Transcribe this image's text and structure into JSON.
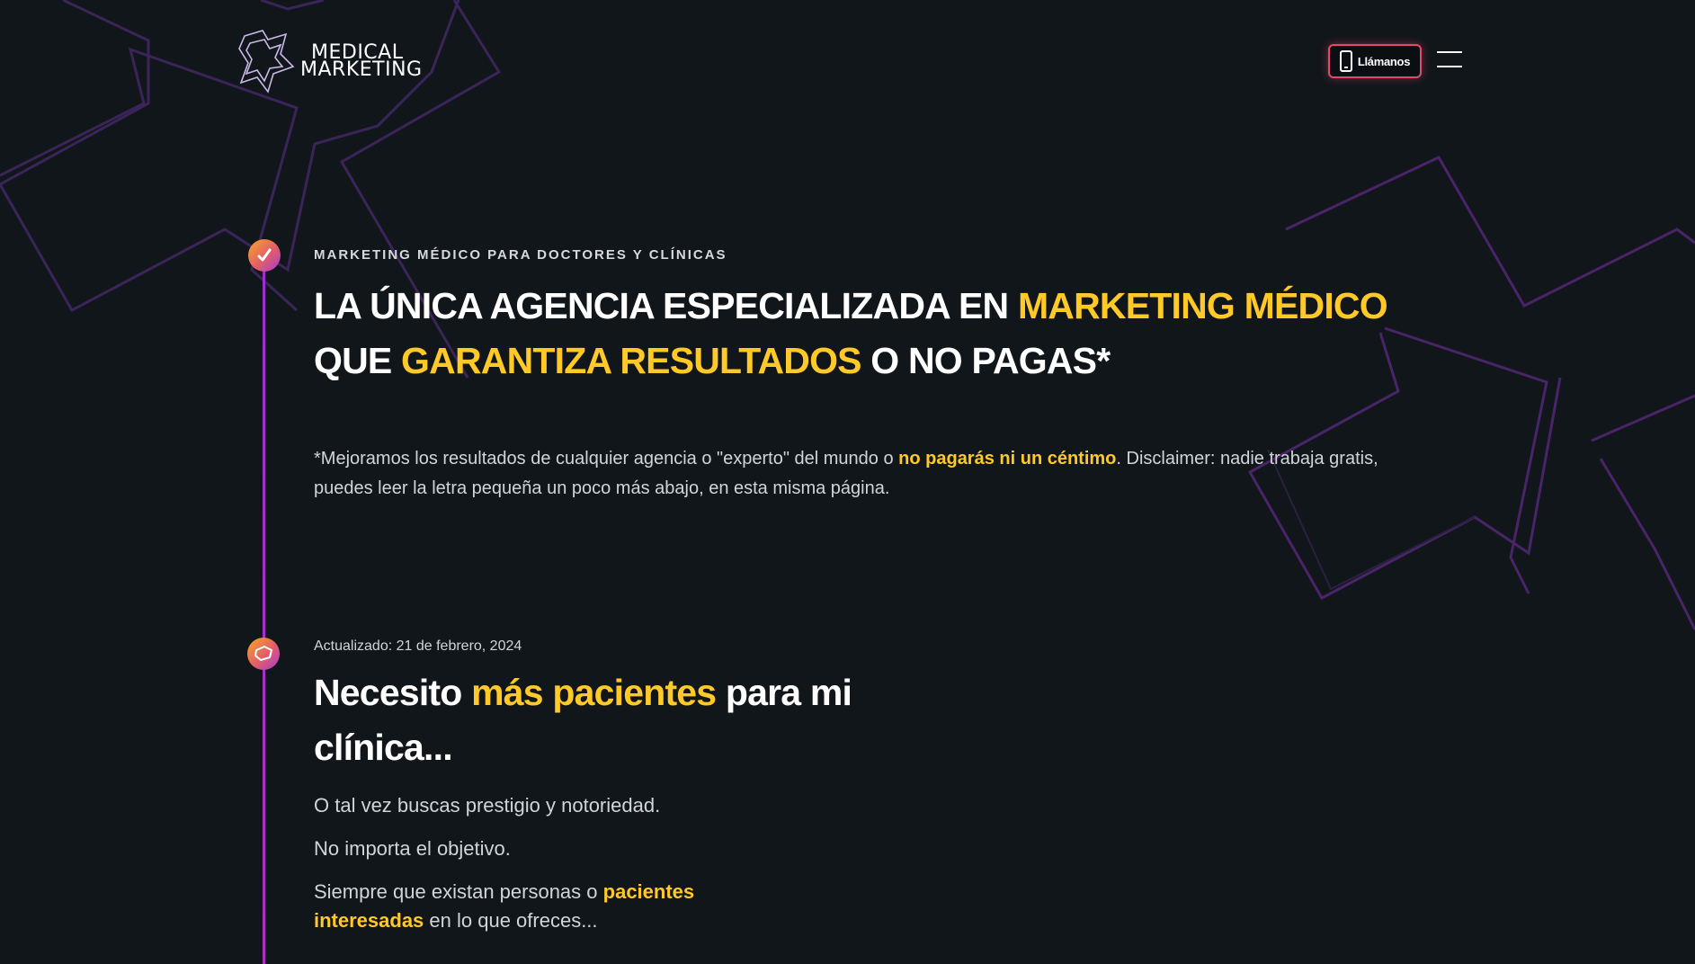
{
  "header": {
    "logo_line1": "MEDICAL",
    "logo_line2": "MARKETING",
    "call_label": "Llámanos",
    "call_icon": "phone-icon",
    "menu_icon": "hamburger-icon"
  },
  "hero": {
    "eyebrow": "MARKETING MÉDICO PARA DOCTORES Y CLÍNICAS",
    "headline_part1": "LA ÚNICA AGENCIA ESPECIALIZADA EN ",
    "headline_hl1": "MARKETING MÉDICO",
    "headline_part2": " QUE ",
    "headline_hl2": "GARANTIZA RESULTADOS",
    "headline_part3": " O NO PAGAS*",
    "disclaimer_part1": "*Mejoramos los resultados de cualquier agencia o \"experto\" del mundo o ",
    "disclaimer_hl": "no pagarás ni un céntimo",
    "disclaimer_part2": ". Disclaimer: nadie trabaja gratis, puedes leer la letra pequeña un poco más abajo, en esta misma página."
  },
  "section2": {
    "updated": "Actualizado: 21 de febrero, 2024",
    "title_part1": "Necesito ",
    "title_hl": "más pacientes",
    "title_part2": " para mi clínica...",
    "p1": "O tal vez buscas prestigio y notoriedad.",
    "p2": "No importa el objetivo.",
    "p3_part1": "Siempre que existan personas o ",
    "p3_hl": "pacientes interesadas",
    "p3_part2": " en lo que ofreces..."
  },
  "colors": {
    "background": "#11161b",
    "accent_yellow": "#ffc928",
    "accent_pink": "#e24a6b",
    "timeline_purple": "#9c2fd0"
  }
}
